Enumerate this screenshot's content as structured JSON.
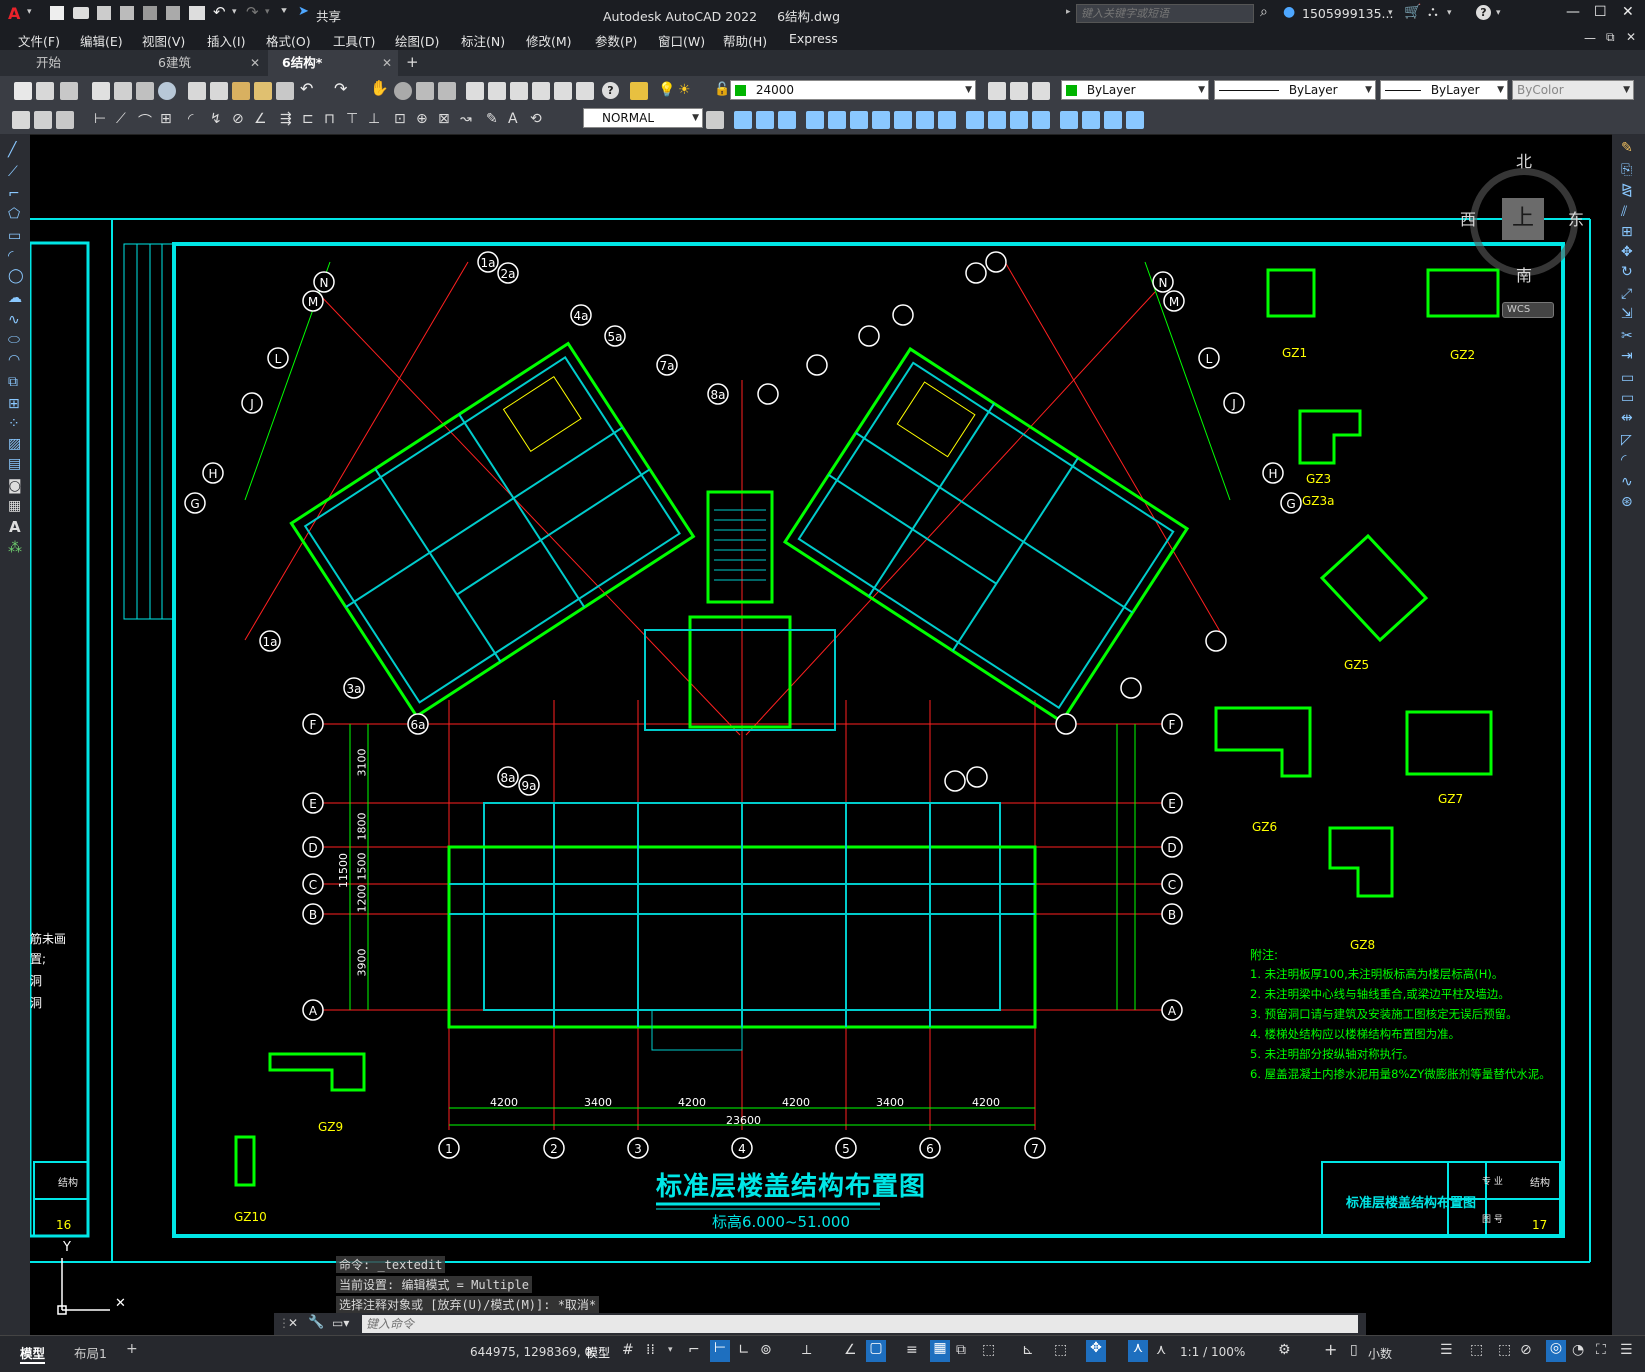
{
  "titlebar": {
    "app_title": "Autodesk AutoCAD 2022",
    "file_name": "6结构.dwg",
    "share_label": "共享",
    "search_placeholder": "键入关键字或短语",
    "user_name": "1505999135...",
    "win_min": "—",
    "win_max": "☐",
    "win_close": "✕"
  },
  "menubar": {
    "items": [
      "文件(F)",
      "编辑(E)",
      "视图(V)",
      "插入(I)",
      "格式(O)",
      "工具(T)",
      "绘图(D)",
      "标注(N)",
      "修改(M)",
      "参数(P)",
      "窗口(W)",
      "帮助(H)",
      "Express"
    ]
  },
  "tabs": [
    {
      "label": "开始",
      "active": false
    },
    {
      "label": "6建筑",
      "active": false
    },
    {
      "label": "6结构*",
      "active": true
    }
  ],
  "toolbar": {
    "layer_value": "24000",
    "color_value": "ByLayer",
    "linetype_value": "ByLayer",
    "lineweight_value": "ByLayer",
    "plotstyle_value": "ByColor",
    "dimstyle_value": "NORMAL"
  },
  "viewcube": {
    "north": "北",
    "south": "南",
    "east": "东",
    "west": "西",
    "top": "上",
    "wcs": "WCS"
  },
  "drawing": {
    "main_title": "标准层楼盖结构布置图",
    "sub_title": "标高6.000~51.000",
    "titleblock_name": "标准层楼盖结构布置图",
    "titleblock_major_label": "专 业",
    "titleblock_major_value": "结构",
    "titleblock_no_label": "图 号",
    "titleblock_no_value": "17",
    "left_titleblock_major": "结构",
    "left_titleblock_no": "16",
    "notes_title": "附注:",
    "notes": [
      "1.  未注明板厚100,未注明板标高为楼层标高(H)。",
      "2.  未注明梁中心线与轴线重合,或梁边平柱及墙边。",
      "3.  预留洞口请与建筑及安装施工图核定无误后预留。",
      "4.  楼梯处结构应以楼梯结构布置图为准。",
      "5.  未注明部分按纵轴对称执行。",
      "6.  屋盖混凝土内掺水泥用量8%ZY微膨胀剂等量替代水泥。"
    ],
    "bottom_axes": [
      "1",
      "2",
      "3",
      "4",
      "5",
      "6",
      "7"
    ],
    "bottom_dims": [
      "4200",
      "3400",
      "4200",
      "4200",
      "3400",
      "4200"
    ],
    "total_dim": "23600",
    "left_axes": [
      "F",
      "E",
      "D",
      "C",
      "B",
      "A"
    ],
    "left_dims": [
      "3100",
      "1800",
      "1500",
      "1200",
      "3900"
    ],
    "left_dim_total": "11500",
    "column_tags": [
      "GZ1",
      "GZ2",
      "GZ3",
      "GZ3a",
      "GZ5",
      "GZ6",
      "GZ7",
      "GZ8",
      "GZ9",
      "GZ10"
    ],
    "left_partial_text": [
      "筋未画",
      "置;",
      "洞",
      "洞"
    ]
  },
  "command": {
    "line1": "命令: _textedit",
    "line2": "当前设置: 编辑模式 = Multiple",
    "line3": "选择注释对象或 [放弃(U)/模式(M)]: *取消*",
    "input_placeholder": "键入命令"
  },
  "status": {
    "tab_model": "模型",
    "tab_layout": "布局1",
    "coords": "644975, 1298369, 0",
    "model_label": "模型",
    "scale": "1:1 / 100%",
    "units": "小数"
  }
}
